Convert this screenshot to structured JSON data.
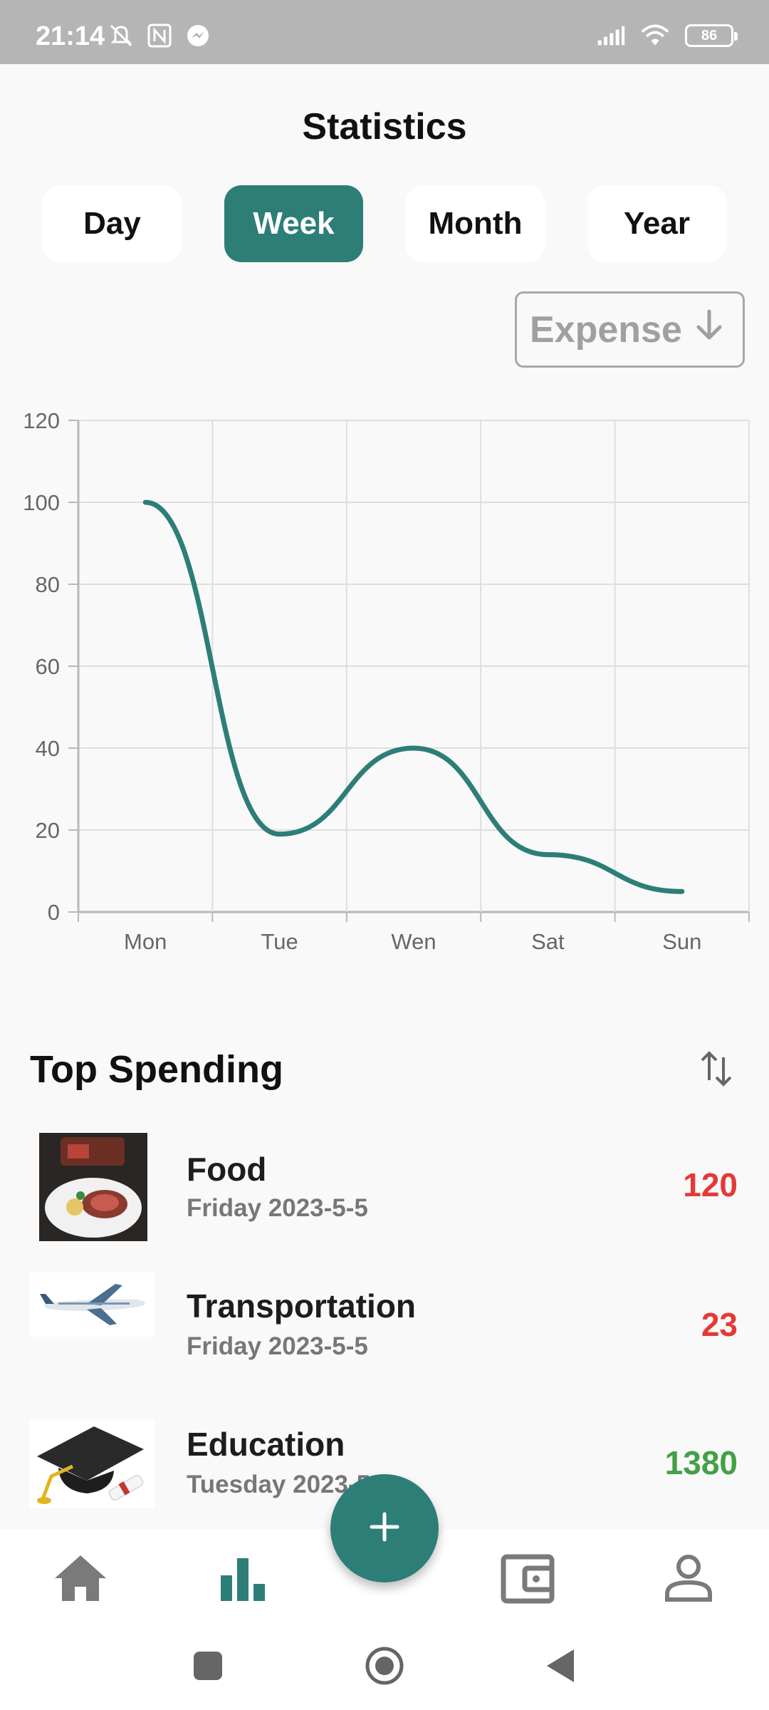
{
  "status_bar": {
    "time": "21:14",
    "battery": "86",
    "icons_left": [
      "mute-icon",
      "nfc-icon",
      "messenger-icon"
    ],
    "icons_right": [
      "signal-icon",
      "wifi-icon",
      "battery-icon"
    ]
  },
  "header": {
    "title": "Statistics"
  },
  "period_tabs": [
    {
      "label": "Day",
      "active": false
    },
    {
      "label": "Week",
      "active": true
    },
    {
      "label": "Month",
      "active": false
    },
    {
      "label": "Year",
      "active": false
    }
  ],
  "type_selector": {
    "label": "Expense",
    "icon": "arrow-down-icon"
  },
  "chart_data": {
    "type": "line",
    "categories": [
      "Mon",
      "Tue",
      "Wen",
      "Sat",
      "Sun"
    ],
    "series": [
      {
        "values": [
          100,
          19,
          40,
          14,
          5
        ]
      }
    ],
    "ylim": [
      0,
      120
    ],
    "yticks": [
      "0",
      "20",
      "40",
      "60",
      "80",
      "100",
      "120"
    ],
    "grid": true,
    "color": "#2e7e78",
    "smooth": true
  },
  "top_spending": {
    "title": "Top Spending",
    "sort_icon": "swap-vertical-icon",
    "items": [
      {
        "title": "Food",
        "subtitle": "Friday  2023-5-5",
        "amount": "120",
        "amount_color": "#e53935",
        "thumb": "food-thumbnail"
      },
      {
        "title": "Transportation",
        "subtitle": "Friday  2023-5-5",
        "amount": "23",
        "amount_color": "#e53935",
        "thumb": "airplane-thumbnail"
      },
      {
        "title": "Education",
        "subtitle": "Tuesday  2023-5-5",
        "amount": "1380",
        "amount_color": "#43a047",
        "thumb": "graduation-cap-thumbnail"
      }
    ]
  },
  "bottom_nav": {
    "items": [
      "home-icon",
      "bar-chart-icon",
      "wallet-icon",
      "profile-icon"
    ],
    "active": "bar-chart-icon",
    "fab_icon": "plus-icon"
  },
  "colors": {
    "accent": "#2e7e78",
    "expense": "#e53935",
    "income": "#43a047"
  }
}
